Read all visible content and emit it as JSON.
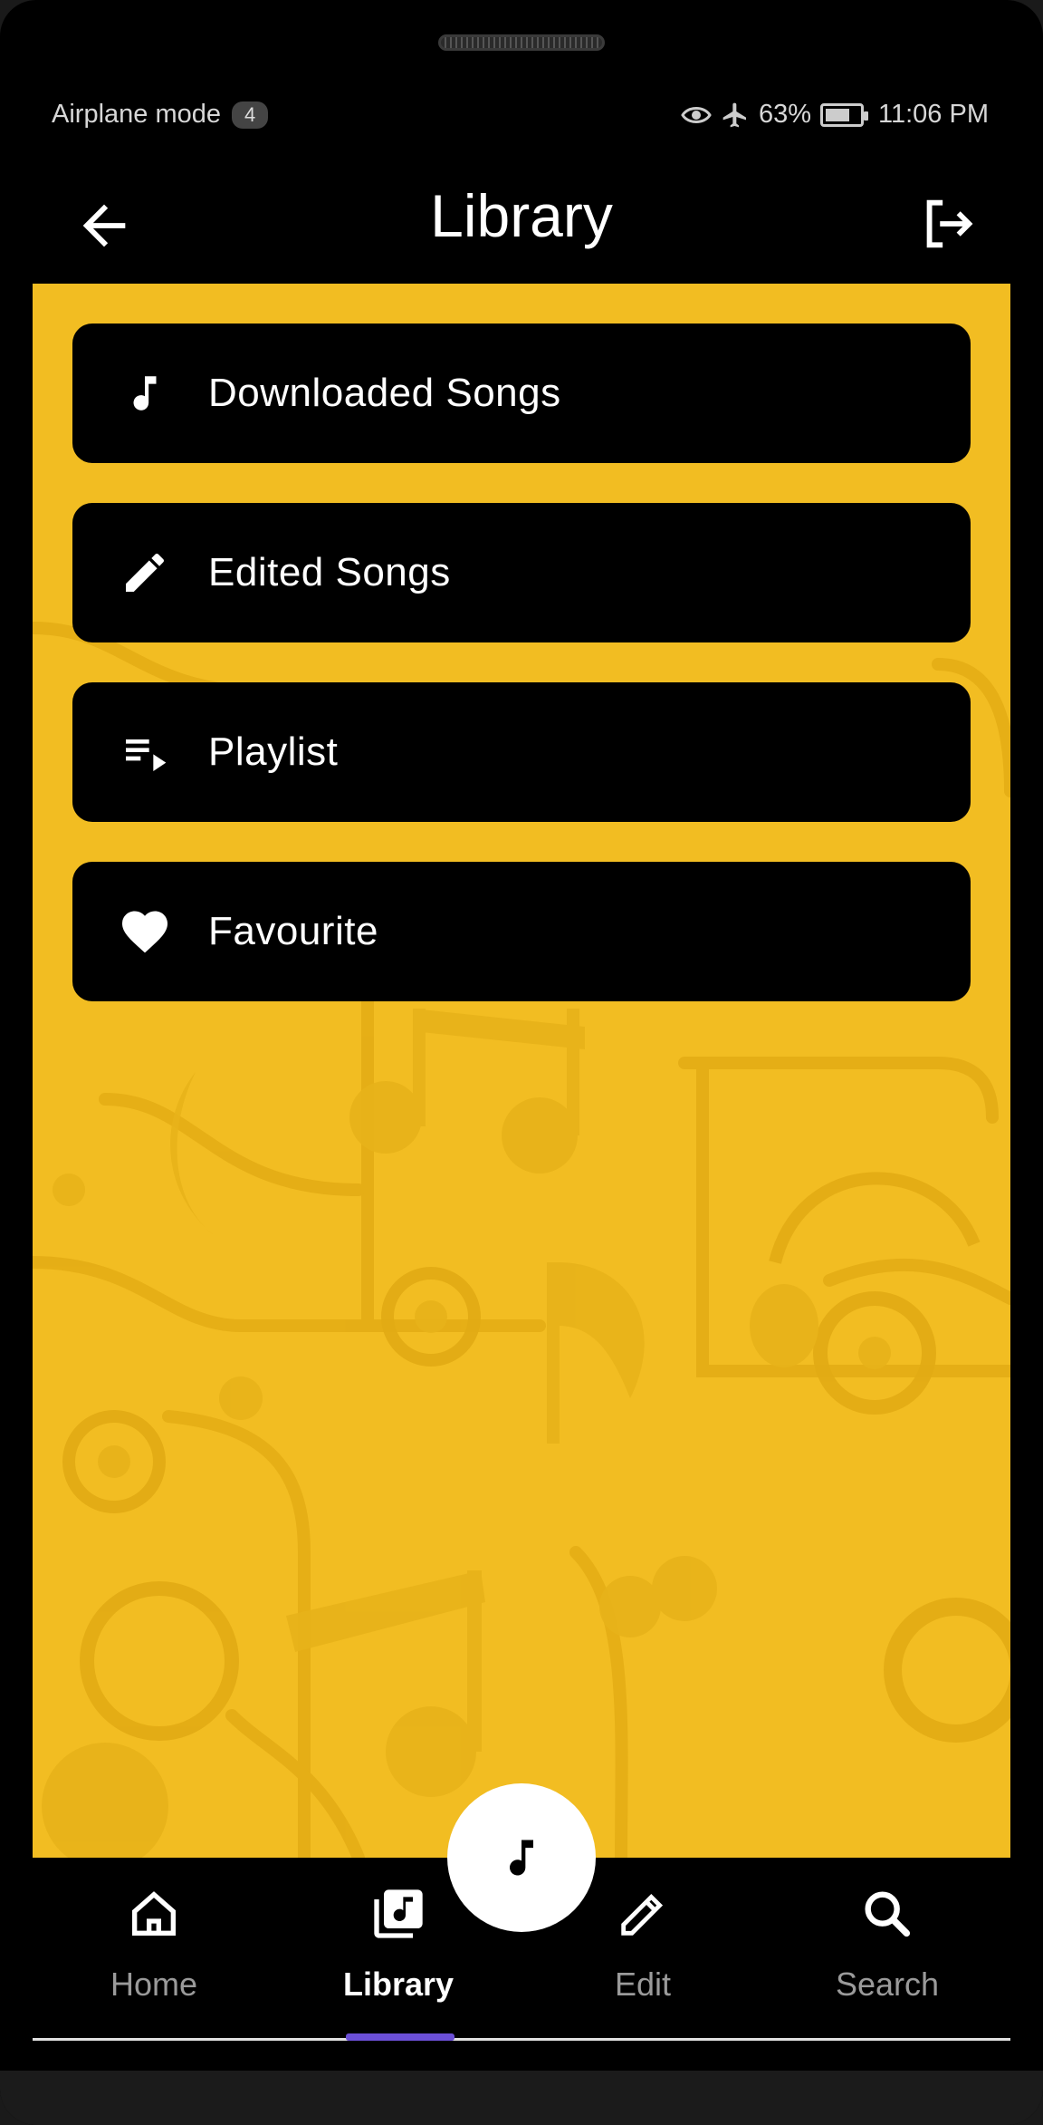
{
  "status_bar": {
    "mode_text": "Airplane mode",
    "mode_badge": "4",
    "battery": "63%",
    "time": "11:06 PM",
    "icons": [
      "eye-icon",
      "airplane-icon",
      "battery-charging-icon"
    ]
  },
  "app_bar": {
    "title": "Library",
    "back_icon": "arrow-left-icon",
    "logout_icon": "logout-icon"
  },
  "menu": [
    {
      "label": "Downloaded Songs",
      "icon": "music-note-icon"
    },
    {
      "label": "Edited Songs",
      "icon": "pencil-icon"
    },
    {
      "label": "Playlist",
      "icon": "playlist-play-icon"
    },
    {
      "label": "Favourite",
      "icon": "heart-icon"
    }
  ],
  "bottom_nav": [
    {
      "label": "Home",
      "icon": "home-icon",
      "active": false
    },
    {
      "label": "Library",
      "icon": "library-music-icon",
      "active": true
    },
    {
      "label": "Edit",
      "icon": "pencil-icon",
      "active": false
    },
    {
      "label": "Search",
      "icon": "search-icon",
      "active": false
    }
  ],
  "fab": {
    "icon": "music-note-icon"
  },
  "colors": {
    "background": "#f2bd22",
    "card": "#000000",
    "nav_indicator": "#6b4fd6",
    "text_primary": "#ffffff",
    "text_muted": "#9a9a9a"
  }
}
